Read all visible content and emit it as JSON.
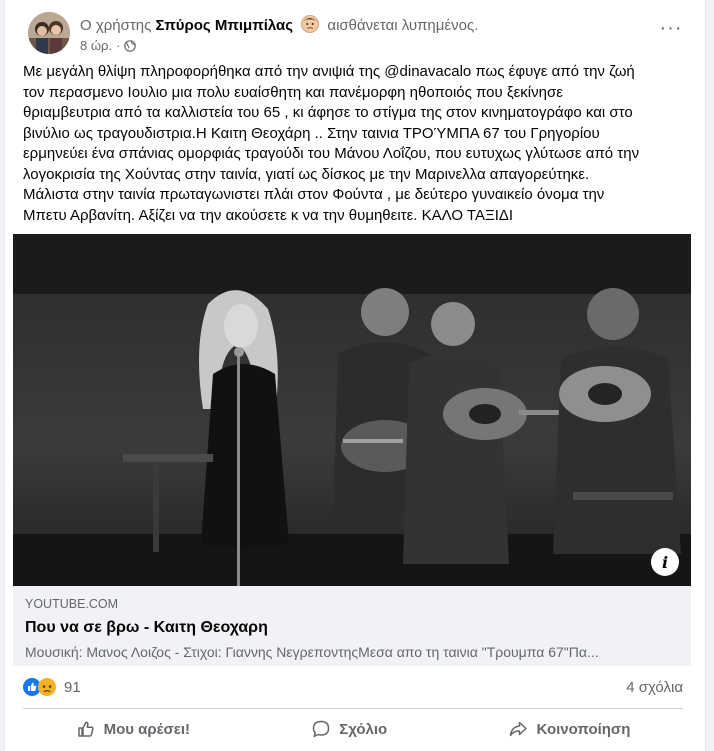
{
  "post": {
    "header_prefix": "Ο χρήστης",
    "author": "Σπύρος Μπιμπίλας",
    "feeling": "αισθάνεται λυπημένος.",
    "time": "8 ώρ.",
    "more_label": "···",
    "text_lines": [
      "Με μεγάλη θλίψη πληροφορήθηκα από την ανιψιά της @dinavacalo  πως έφυγε από την ζωή",
      "τον περασμενο Ιουλιο μια πολυ ευαίσθητη και πανέμορφη  ηθοποιός που ξεκίνησε",
      "θριαμβευτρια από τα καλλιστεία του 65 , κι άφησε το στίγμα της στον κινηματογράφο και στο",
      "βινύλιο ως τραγουδιστρια.Η Καιτη Θεοχάρη ..  Στην ταινια ΤΡΟΎΜΠΑ 67  του Γρηγορίου",
      "ερμηνεύει ένα σπάνιας ομορφιάς τραγούδι του Μάνου Λοΐζου, που ευτυχως γλύτωσε από την",
      "λογοκρισία της Χούντας στην ταινία, γιατί ως δίσκος με την Μαρινελλα απαγορεύτηκε.",
      "Μάλιστα στην ταινία πρωταγωνιστει πλάι στον Φούντα , με δεύτερο γυναικείο όνομα την",
      "Μπετυ  Αρβανίτη. Αξίζει να την ακούσετε κ να την θυμηθειτε. ΚΑΛΟ ΤΑΞΙΔΙ"
    ]
  },
  "video": {
    "info_icon": "i"
  },
  "link_preview": {
    "domain": "YOUTUBE.COM",
    "title": "Που να σε βρω - Καιτη Θεοχαρη",
    "description": "Μουσική: Μανος Λοιζος - Στιχοι: Γιαννης ΝεγρεποντηςΜεσα απο τη ταινια \"Τρουμπα 67\"Πα..."
  },
  "stats": {
    "reaction_count": "91",
    "comments": "4 σχόλια"
  },
  "actions": {
    "like": "Μου αρέσει!",
    "comment": "Σχόλιο",
    "share": "Κοινοποίηση"
  },
  "colors": {
    "like_blue": "#1877f2",
    "sad_yellow": "#f7b125",
    "secondary_text": "#65676b"
  }
}
